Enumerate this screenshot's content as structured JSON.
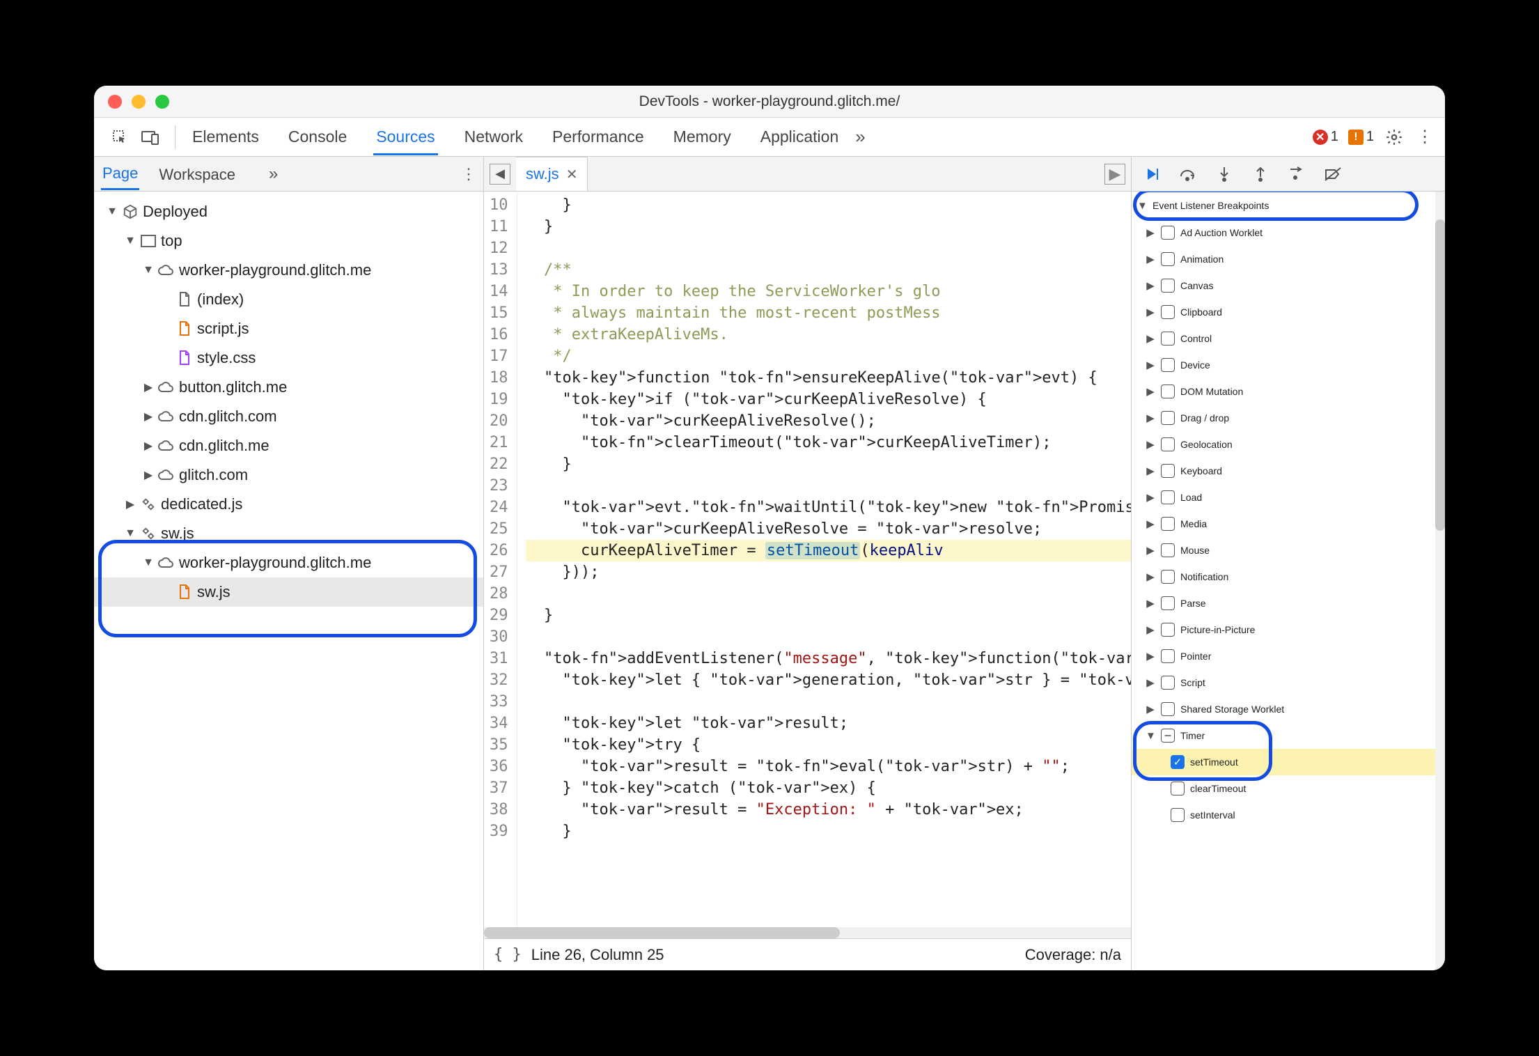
{
  "window": {
    "title": "DevTools - worker-playground.glitch.me/"
  },
  "toolbar": {
    "tabs": [
      "Elements",
      "Console",
      "Sources",
      "Network",
      "Performance",
      "Memory",
      "Application"
    ],
    "active": "Sources",
    "errors": "1",
    "warnings": "1"
  },
  "navigator": {
    "tabs": [
      "Page",
      "Workspace"
    ],
    "active": "Page",
    "tree": {
      "deployed": "Deployed",
      "top": "top",
      "origin1": "worker-playground.glitch.me",
      "files1": [
        "(index)",
        "script.js",
        "style.css"
      ],
      "origins_collapsed": [
        "button.glitch.me",
        "cdn.glitch.com",
        "cdn.glitch.me",
        "glitch.com"
      ],
      "dedicated": "dedicated.js",
      "sw_worker": "sw.js",
      "sw_origin": "worker-playground.glitch.me",
      "sw_file": "sw.js"
    }
  },
  "editor": {
    "file_tab": "sw.js",
    "first_line": 10,
    "lines": [
      "    }",
      "  }",
      "",
      "  /**",
      "   * In order to keep the ServiceWorker's glo",
      "   * always maintain the most-recent postMess",
      "   * extraKeepAliveMs.",
      "   */",
      "  function ensureKeepAlive(evt) {",
      "    if (curKeepAliveResolve) {",
      "      curKeepAliveResolve();",
      "      clearTimeout(curKeepAliveTimer);",
      "    }",
      "",
      "    evt.waitUntil(new Promise((resolve) => {",
      "      curKeepAliveResolve = resolve;",
      "      curKeepAliveTimer = setTimeout(keepAliv",
      "    }));",
      "",
      "  }",
      "",
      "  addEventListener(\"message\", function(evt) {",
      "    let { generation, str } = evt.data;",
      "",
      "    let result;",
      "    try {",
      "      result = eval(str) + \"\";",
      "    } catch (ex) {",
      "      result = \"Exception: \" + ex;",
      "    }"
    ],
    "paused_line_index": 16
  },
  "status": {
    "pos": "Line 26, Column 25",
    "coverage": "Coverage: n/a"
  },
  "debugger": {
    "section": "Event Listener Breakpoints",
    "categories": [
      "Ad Auction Worklet",
      "Animation",
      "Canvas",
      "Clipboard",
      "Control",
      "Device",
      "DOM Mutation",
      "Drag / drop",
      "Geolocation",
      "Keyboard",
      "Load",
      "Media",
      "Mouse",
      "Notification",
      "Parse",
      "Picture-in-Picture",
      "Pointer",
      "Script",
      "Shared Storage Worklet"
    ],
    "timer": {
      "label": "Timer",
      "children": [
        {
          "label": "setTimeout",
          "checked": true
        },
        {
          "label": "clearTimeout",
          "checked": false
        },
        {
          "label": "setInterval",
          "checked": false
        }
      ]
    }
  }
}
